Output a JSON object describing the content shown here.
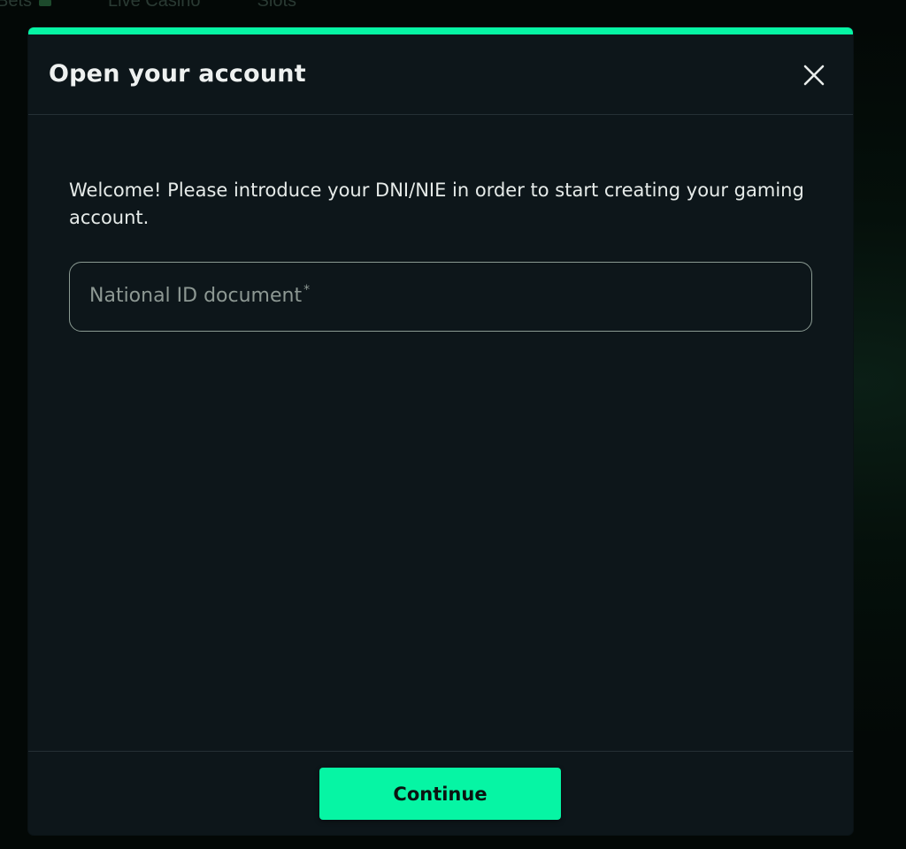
{
  "background_nav": {
    "items": [
      "Bets",
      "Live Casino",
      "Slots"
    ]
  },
  "modal": {
    "title": "Open your account",
    "close_icon": "close-icon",
    "intro_text": "Welcome! Please introduce your DNI/NIE in order to start creating your gaming account.",
    "id_field": {
      "label": "National ID document",
      "required_marker": "*",
      "value": ""
    },
    "continue_label": "Continue"
  },
  "colors": {
    "accent": "#06f5a4",
    "modal_background": "#0d161a",
    "page_background": "#030806"
  }
}
